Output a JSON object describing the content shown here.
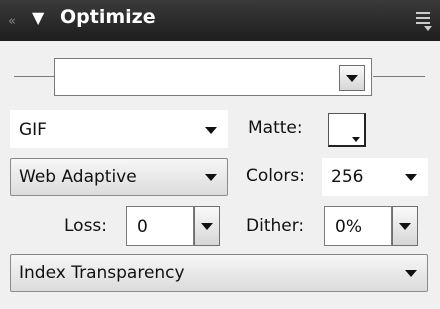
{
  "panel": {
    "title": "Optimize",
    "grip_icon": "panel-grip-icon",
    "collapse_icon": "triangle-down-icon",
    "menu_icon": "panel-options-menu-icon"
  },
  "preset": {
    "value": ""
  },
  "format": {
    "value": "GIF"
  },
  "matte": {
    "label": "Matte:",
    "color": "#ffffff"
  },
  "palette": {
    "value": "Web Adaptive"
  },
  "colors": {
    "label": "Colors:",
    "value": "256"
  },
  "loss": {
    "label": "Loss:",
    "value": "0"
  },
  "dither": {
    "label": "Dither:",
    "value": "0%"
  },
  "transparency": {
    "value": "Index Transparency"
  }
}
